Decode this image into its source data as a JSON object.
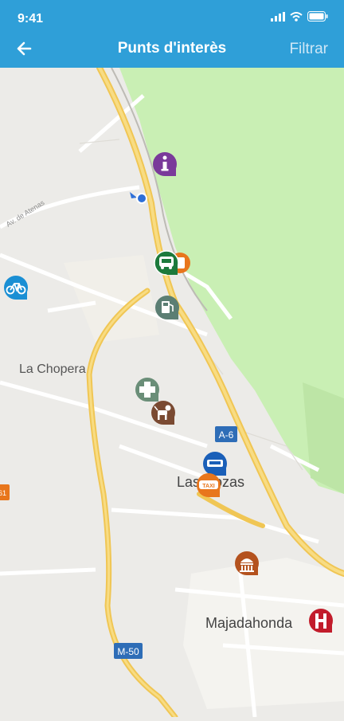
{
  "status_bar": {
    "time": "9:41"
  },
  "header": {
    "title": "Punts d'interès",
    "filter_label": "Filtrar"
  },
  "map": {
    "labels": {
      "street": "Av. de Atenas",
      "la_chopera": "La Chopera",
      "las_rozas": "Las Rozas",
      "majadahonda": "Majadahonda",
      "a6": "A-6",
      "m50": "M-50",
      "edge_marker": "61",
      "taxi": "TAXI"
    },
    "pois": [
      {
        "type": "info",
        "icon": "info-icon",
        "color": "#7a3a9a"
      },
      {
        "type": "bus",
        "icon": "bus-icon",
        "color": "#1c7a3c"
      },
      {
        "type": "bicycle",
        "icon": "bicycle-icon",
        "color": "#1a8fd4"
      },
      {
        "type": "fuel",
        "icon": "fuel-icon",
        "color": "#5b7e73"
      },
      {
        "type": "pharmacy",
        "icon": "cross-icon",
        "color": "#6a8e78"
      },
      {
        "type": "pets",
        "icon": "dog-icon",
        "color": "#7a4a32"
      },
      {
        "type": "parking",
        "icon": "parking-icon",
        "color": "#1a5fb8"
      },
      {
        "type": "taxi",
        "icon": "taxi-icon",
        "color": "#e8761c"
      },
      {
        "type": "monument",
        "icon": "monument-icon",
        "color": "#b4521e"
      },
      {
        "type": "hospital",
        "icon": "hospital-icon",
        "color": "#c21c2b"
      }
    ]
  }
}
